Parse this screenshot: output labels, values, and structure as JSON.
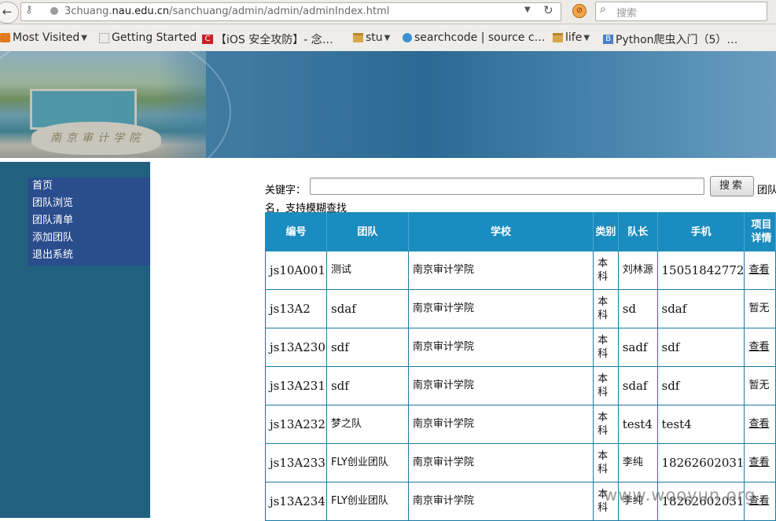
{
  "browser": {
    "url_prefix": "3chuang.",
    "url_domain": "nau.edu.cn",
    "url_path": "/sanchuang/admin/admin/adminIndex.html",
    "search_placeholder": "搜索",
    "bookmarks": [
      {
        "label": "Most Visited",
        "icon": "rss-icon",
        "has_menu": true
      },
      {
        "label": "Getting Started",
        "icon": "page-icon"
      },
      {
        "label": "【iOS 安全攻防】- 念…",
        "icon": "c-icon"
      },
      {
        "label": "stu",
        "icon": "folder-icon",
        "has_menu": true
      },
      {
        "label": "searchcode | source c…",
        "icon": "q-icon"
      },
      {
        "label": "life",
        "icon": "folder-icon",
        "has_menu": true
      },
      {
        "label": "Python爬虫入门（5）…",
        "icon": "b-icon"
      }
    ]
  },
  "banner": {
    "stone_inscription": "南京审计学院"
  },
  "sidebar": {
    "items": [
      {
        "label": "首页"
      },
      {
        "label": "团队浏览"
      },
      {
        "label": "团队清单"
      },
      {
        "label": "添加团队"
      },
      {
        "label": "退出系统"
      }
    ]
  },
  "search": {
    "label": "关键字：",
    "button": "搜索",
    "hint_a": "团队",
    "hint_b": "名，支持模糊查找"
  },
  "table": {
    "headers": [
      "编号",
      "团队",
      "学校",
      "类别",
      "队长",
      "手机",
      "项目详情"
    ],
    "rows": [
      {
        "id": "js10A001",
        "team": "测试",
        "school": "南京审计学院",
        "cat": "本科",
        "leader": "刘林源",
        "phone": "15051842772",
        "detail": "查看"
      },
      {
        "id": "js13A2",
        "team": "sdaf",
        "school": "南京审计学院",
        "cat": "本科",
        "leader": "sd",
        "phone": "sdaf",
        "detail": "暂无"
      },
      {
        "id": "js13A230",
        "team": "sdf",
        "school": "南京审计学院",
        "cat": "本科",
        "leader": "sadf",
        "phone": "sdf",
        "detail": "查看"
      },
      {
        "id": "js13A231",
        "team": "sdf",
        "school": "南京审计学院",
        "cat": "本科",
        "leader": "sdaf",
        "phone": "sdf",
        "detail": "暂无"
      },
      {
        "id": "js13A232",
        "team": "梦之队",
        "school": "南京审计学院",
        "cat": "本科",
        "leader": "test4",
        "phone": "test4",
        "detail": "查看"
      },
      {
        "id": "js13A233",
        "team": "FLY创业团队",
        "school": "南京审计学院",
        "cat": "本科",
        "leader": "李纯",
        "phone": "18262602031",
        "detail": "查看"
      },
      {
        "id": "js13A234",
        "team": "FLY创业团队",
        "school": "南京审计学院",
        "cat": "本科",
        "leader": "李纯",
        "phone": "18262602031",
        "detail": "查看"
      }
    ]
  },
  "watermark": "www.wooyun.org",
  "colors": {
    "header_bg": "#1a8cbf",
    "sidebar_bg": "#21607f",
    "menu_bg": "#2a4d8d",
    "link": "#1a5aa6"
  }
}
